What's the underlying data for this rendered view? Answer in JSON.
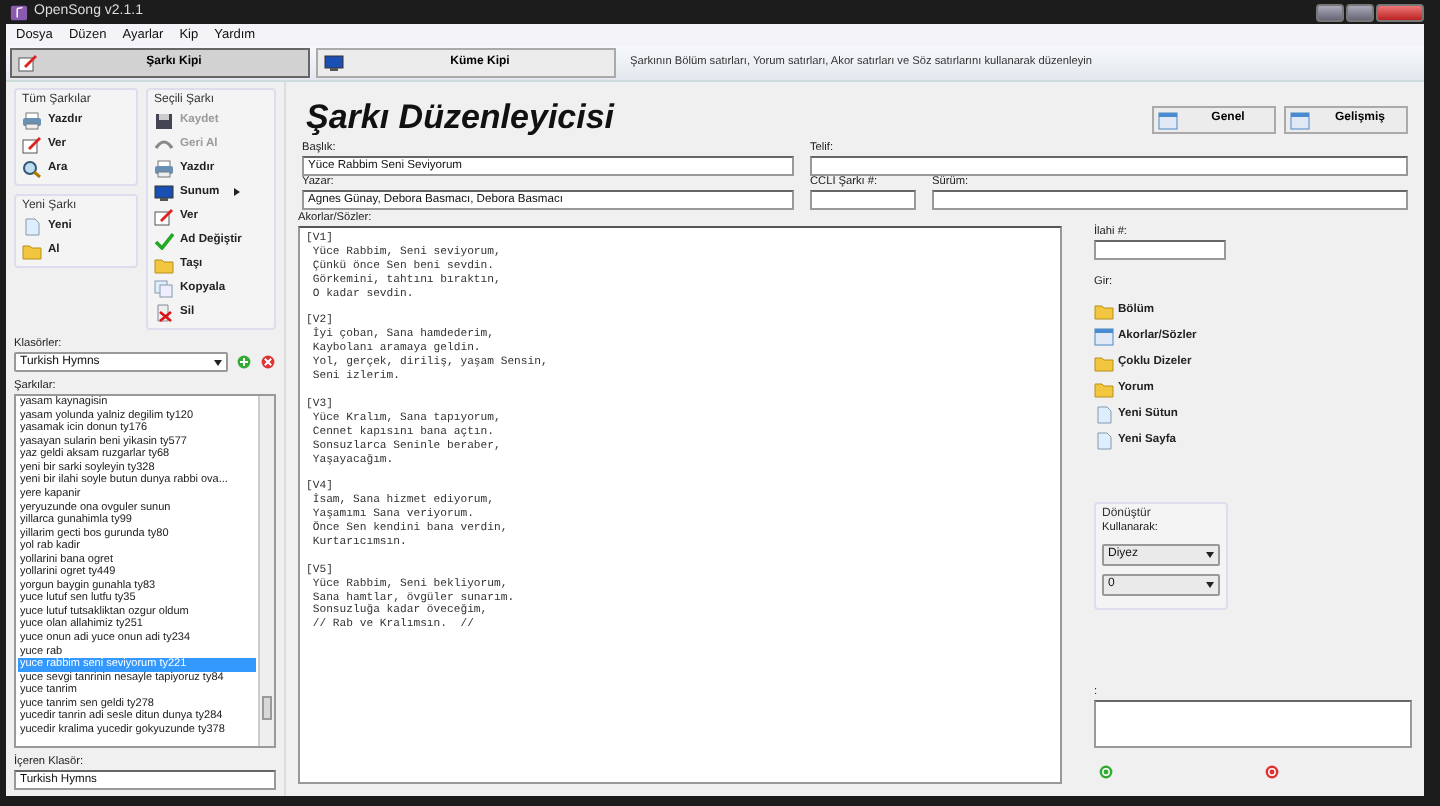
{
  "window": {
    "title": "OpenSong v2.1.1"
  },
  "menu": [
    "Dosya",
    "Düzen",
    "Ayarlar",
    "Kip",
    "Yardım"
  ],
  "modes": [
    {
      "label": "Şarkı Kipi",
      "selected": true
    },
    {
      "label": "Küme Kipi",
      "selected": false
    }
  ],
  "hint": "Şarkının Bölüm satırları, Yorum satırları, Akor satırları ve Söz satırlarını kullanarak düzenleyin",
  "all_songs": {
    "title": "Tüm Şarkılar",
    "actions": [
      {
        "label": "Yazdır",
        "disabled": false
      },
      {
        "label": "Ver",
        "disabled": false
      },
      {
        "label": "Ara",
        "disabled": false
      }
    ]
  },
  "new_song": {
    "title": "Yeni Şarkı",
    "actions": [
      {
        "label": "Yeni",
        "disabled": false
      },
      {
        "label": "Al",
        "disabled": false
      }
    ]
  },
  "selected_song": {
    "title": "Seçili Şarkı",
    "actions": [
      {
        "label": "Kaydet",
        "disabled": true,
        "submenu": false
      },
      {
        "label": "Geri Al",
        "disabled": true,
        "submenu": false
      },
      {
        "label": "Yazdır",
        "disabled": false,
        "submenu": false
      },
      {
        "label": "Sunum",
        "disabled": false,
        "submenu": true
      },
      {
        "label": "Ver",
        "disabled": false,
        "submenu": false
      },
      {
        "label": "Ad Değiştir",
        "disabled": false,
        "submenu": false
      },
      {
        "label": "Taşı",
        "disabled": false,
        "submenu": false
      },
      {
        "label": "Kopyala",
        "disabled": false,
        "submenu": false
      },
      {
        "label": "Sil",
        "disabled": false,
        "submenu": false
      }
    ]
  },
  "folders": {
    "label": "Klasörler:",
    "value": "Turkish Hymns"
  },
  "songs": {
    "label": "Şarkılar:",
    "items": [
      {
        "label": "yasam kaynagisin",
        "selected": false
      },
      {
        "label": "yasam yolunda yalniz degilim ty120",
        "selected": false
      },
      {
        "label": "yasamak icin donun ty176",
        "selected": false
      },
      {
        "label": "yasayan sularin beni yikasin ty577",
        "selected": false
      },
      {
        "label": "yaz geldi aksam ruzgarlar ty68",
        "selected": false
      },
      {
        "label": "yeni bir sarki soyleyin ty328",
        "selected": false
      },
      {
        "label": "yeni bir ilahi soyle butun dunya rabbi ova...",
        "selected": false
      },
      {
        "label": "yere kapanir",
        "selected": false
      },
      {
        "label": "yeryuzunde ona ovguler sunun",
        "selected": false
      },
      {
        "label": "yillarca gunahimla ty99",
        "selected": false
      },
      {
        "label": "yillarim gecti bos gurunda ty80",
        "selected": false
      },
      {
        "label": "yol rab kadir",
        "selected": false
      },
      {
        "label": "yollarini bana ogret",
        "selected": false
      },
      {
        "label": "yollarini ogret ty449",
        "selected": false
      },
      {
        "label": "yorgun baygin gunahla ty83",
        "selected": false
      },
      {
        "label": "yuce lutuf sen lutfu ty35",
        "selected": false
      },
      {
        "label": "yuce lutuf tutsakliktan ozgur oldum",
        "selected": false
      },
      {
        "label": "yuce olan allahimiz ty251",
        "selected": false
      },
      {
        "label": "yuce onun adi yuce onun adi ty234",
        "selected": false
      },
      {
        "label": "yuce rab",
        "selected": false
      },
      {
        "label": "yuce rabbim seni seviyorum ty221",
        "selected": true
      },
      {
        "label": "yuce sevgi tanrinin nesayle tapiyoruz ty84",
        "selected": false
      },
      {
        "label": "yuce tanrim",
        "selected": false
      },
      {
        "label": "yuce tanrim sen geldi ty278",
        "selected": false
      },
      {
        "label": "yucedir tanrin adi sesle ditun dunya ty284",
        "selected": false
      },
      {
        "label": "yucedir kralima yucedir gokyuzunde ty378",
        "selected": false
      }
    ]
  },
  "containing_folder": {
    "label": "İçeren Klasör:",
    "value": "Turkish Hymns"
  },
  "editor": {
    "heading": "Şarkı Düzenleyicisi",
    "buttons": [
      "Genel",
      "Gelişmiş"
    ],
    "title": {
      "label": "Başlık:",
      "value": "Yüce Rabbim Seni Seviyorum"
    },
    "copyright": {
      "label": "Telif:"
    },
    "author": {
      "label": "Yazar:",
      "value": "Agnes Günay, Debora Basmacı, Debora Basmacı"
    },
    "ccli": {
      "label": "CCLI Şarkı #:"
    },
    "version": {
      "label": "Sürüm:"
    },
    "lyrics": {
      "label": "Akorlar/Sözler:",
      "text": "[V1]\n Yüce Rabbim, Seni seviyorum,\n Çünkü önce Sen beni sevdin.\n Görkemini, tahtını bıraktın,\n O kadar sevdin.\n\n[V2]\n İyi çoban, Sana hamdederim,\n Kaybolanı aramaya geldin.\n Yol, gerçek, diriliş, yaşam Sensin,\n Seni izlerim.\n\n[V3]\n Yüce Kralım, Sana tapıyorum,\n Cennet kapısını bana açtın.\n Sonsuzlarca Seninle beraber,\n Yaşayacağım.\n\n[V4]\n İsam, Sana hizmet ediyorum,\n Yaşamımı Sana veriyorum.\n Önce Sen kendini bana verdin,\n Kurtarıcımsın.\n\n[V5]\n Yüce Rabbim, Seni bekliyorum,\n Sana hamtlar, övgüler sunarım.\n Sonsuzluğa kadar öveceğim,\n // Rab ve Kralımsın.  //"
    }
  },
  "side": {
    "hymn_number": {
      "label": "İlahi #:"
    },
    "insert": {
      "label": "Gir:",
      "items": [
        "Bölüm",
        "Akorlar/Sözler",
        "Çoklu Dizeler",
        "Yorum",
        "Yeni Sütun",
        "Yeni Sayfa"
      ]
    },
    "convert": {
      "title": "Dönüştür",
      "using_label": "Kullanarak:",
      "selects": [
        "Diyez",
        "0"
      ]
    },
    "notes": {
      "label": ":"
    }
  }
}
